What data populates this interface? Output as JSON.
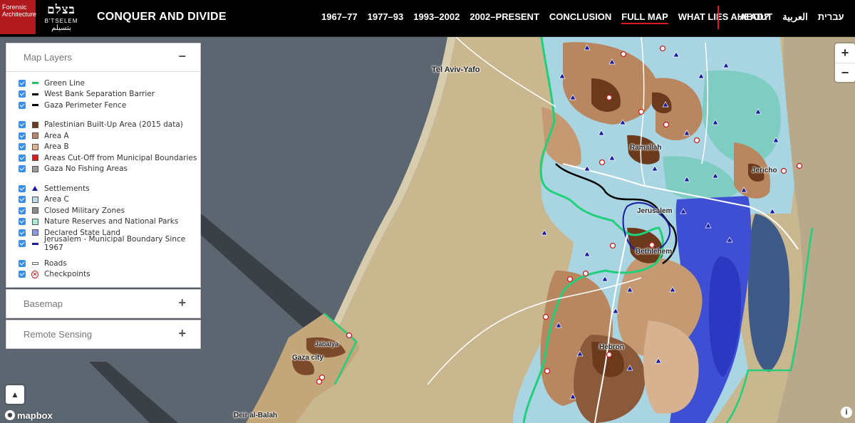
{
  "header": {
    "fa_logo": "Forensic Architecture",
    "btselem_logo": {
      "hebrew": "בצלם",
      "latin": "B'TSELEM",
      "arabic": "بتسيلم"
    },
    "title": "CONQUER AND DIVIDE",
    "nav": [
      {
        "label": "1967–77",
        "active": false
      },
      {
        "label": "1977–93",
        "active": false
      },
      {
        "label": "1993–2002",
        "active": false
      },
      {
        "label": "2002–PRESENT",
        "active": false
      },
      {
        "label": "CONCLUSION",
        "active": false
      },
      {
        "label": "FULL MAP",
        "active": true
      },
      {
        "label": "WHAT LIES AHEAD?",
        "active": false
      }
    ],
    "secondary_nav": [
      "ABOUT",
      "العربية",
      "עברית"
    ],
    "accent_color": "#d81e25"
  },
  "panel": {
    "map_layers": {
      "title": "Map Layers",
      "toggle": "−",
      "groups": [
        [
          {
            "label": "Green Line",
            "checked": true,
            "swatch": "line",
            "color": "#22c46a"
          },
          {
            "label": "West Bank Separation Barrier",
            "checked": true,
            "swatch": "line",
            "color": "#000000"
          },
          {
            "label": "Gaza Perimeter Fence",
            "checked": true,
            "swatch": "line",
            "color": "#000000"
          }
        ],
        [
          {
            "label": "Palestinian Built-Up Area (2015 data)",
            "checked": true,
            "swatch": "box",
            "color": "#6b3a1c"
          },
          {
            "label": "Area A",
            "checked": true,
            "swatch": "box",
            "color": "#b88463"
          },
          {
            "label": "Area B",
            "checked": true,
            "swatch": "box",
            "color": "#e3b08e"
          },
          {
            "label": "Areas Cut-Off from Municipal Boundaries",
            "checked": true,
            "swatch": "box",
            "color": "#d42020"
          },
          {
            "label": "Gaza No Fishing Areas",
            "checked": true,
            "swatch": "box",
            "color": "#9a9a9a"
          }
        ],
        [
          {
            "label": "Settlements",
            "checked": true,
            "swatch": "triangle",
            "color": "#1a1aa0"
          },
          {
            "label": "Area C",
            "checked": true,
            "swatch": "box",
            "color": "#b9dbe8"
          },
          {
            "label": "Closed Military Zones",
            "checked": true,
            "swatch": "box",
            "color": "#8c8c8c"
          },
          {
            "label": "Nature Reserves and National Parks",
            "checked": true,
            "swatch": "box",
            "color": "#a8ecd8"
          },
          {
            "label": "Declared State Land",
            "checked": true,
            "swatch": "box",
            "color": "#8a96e8"
          },
          {
            "label": "Jerusalem - Municipal Boundary Since 1967",
            "checked": true,
            "swatch": "line",
            "color": "#1a1a9a"
          }
        ],
        [
          {
            "label": "Roads",
            "checked": true,
            "swatch": "road",
            "color": "#ffffff"
          },
          {
            "label": "Checkpoints",
            "checked": true,
            "swatch": "checkpoint",
            "color": "#c41c1c"
          }
        ]
      ]
    },
    "basemap": {
      "title": "Basemap",
      "toggle": "+"
    },
    "remote_sensing": {
      "title": "Remote Sensing",
      "toggle": "+"
    }
  },
  "map": {
    "places": [
      "Tel Aviv-Yafo",
      "Ramallah",
      "Jericho",
      "Jerusalem",
      "Bethlehem",
      "Hebron",
      "Jabalya",
      "Gaza city",
      "Deir al-Balah"
    ],
    "zoom_in": "+",
    "zoom_out": "−",
    "compass": "▲",
    "attribution": "mapbox",
    "info": "i"
  }
}
